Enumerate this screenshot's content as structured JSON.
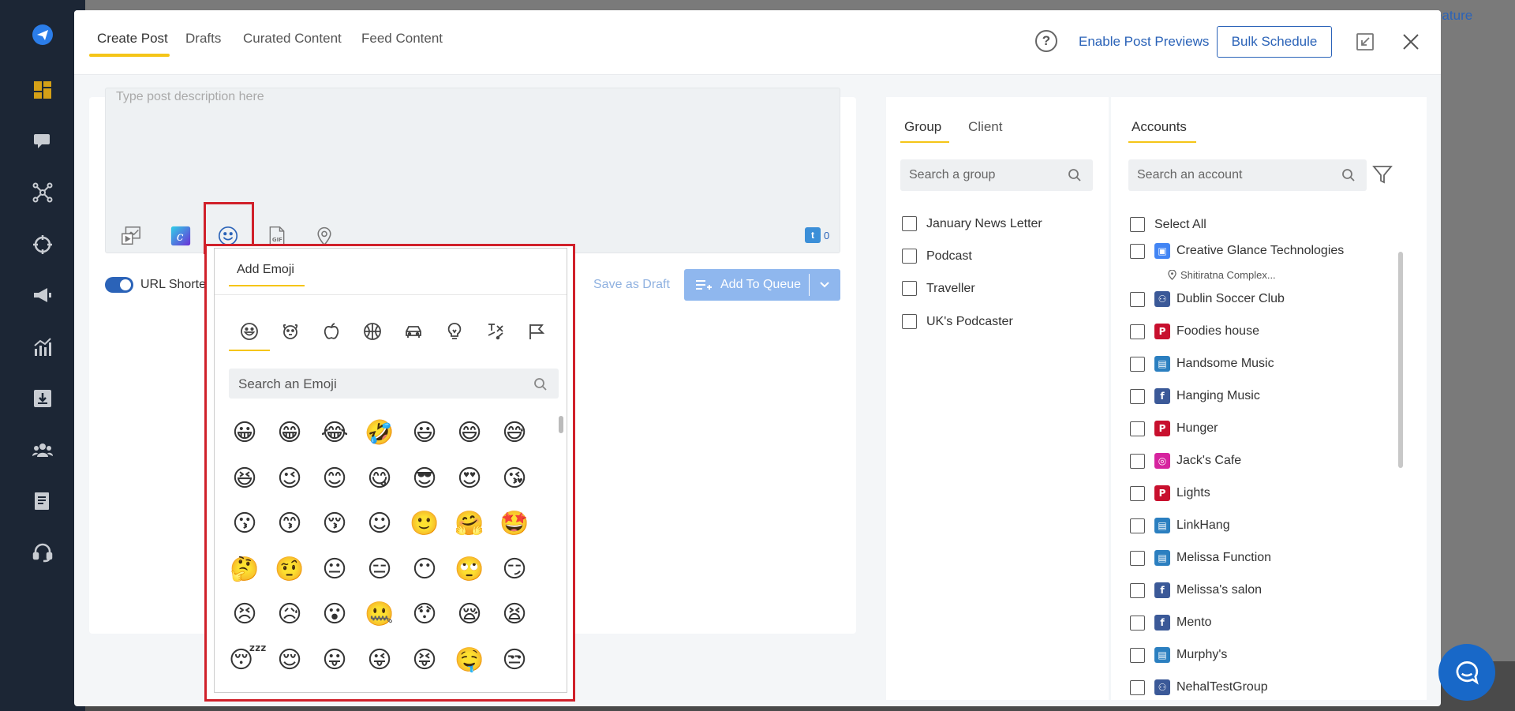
{
  "colors": {
    "accent": "#2b63b8",
    "highlight": "#d0202a",
    "underline": "#f5c518",
    "sidebar": "#1c2635"
  },
  "backdrop": {
    "feature_text": "eature"
  },
  "sidebar": {
    "icons": [
      "logo-plane-icon",
      "dashboard-icon",
      "chat-icon",
      "network-icon",
      "target-icon",
      "megaphone-icon",
      "analytics-icon",
      "download-icon",
      "team-icon",
      "reports-icon",
      "support-headset-icon"
    ]
  },
  "header": {
    "tabs": [
      {
        "label": "Create Post"
      },
      {
        "label": "Drafts"
      },
      {
        "label": "Curated Content"
      },
      {
        "label": "Feed Content"
      }
    ],
    "help_symbol": "?",
    "enable_previews": "Enable Post Previews",
    "bulk_schedule": "Bulk Schedule"
  },
  "composer": {
    "placeholder": "Type post description here",
    "twitter_count": "0",
    "twitter_badge": "t",
    "url_shortener": "URL Shortener",
    "save_as_draft": "Save as Draft",
    "add_to_queue": "Add To Queue"
  },
  "emoji_panel": {
    "tab_label": "Add Emoji",
    "search_placeholder": "Search an Emoji",
    "categories": [
      "smileys-icon",
      "animals-icon",
      "food-icon",
      "activity-icon",
      "travel-icon",
      "objects-icon",
      "symbols-icon",
      "flags-icon"
    ],
    "emojis": [
      [
        "😀",
        "😁",
        "😂",
        "🤣",
        "😃",
        "😄",
        "😅"
      ],
      [
        "😆",
        "😉",
        "😊",
        "😋",
        "😎",
        "😍",
        "😘"
      ],
      [
        "😗",
        "😙",
        "😚",
        "☺",
        "🙂",
        "🤗",
        "🤩"
      ],
      [
        "🤔",
        "🤨",
        "😐",
        "😑",
        "😶",
        "🙄",
        "😏"
      ],
      [
        "😣",
        "😥",
        "😮",
        "🤐",
        "😯",
        "😪",
        "😫"
      ],
      [
        "😴",
        "😌",
        "😛",
        "😜",
        "😝",
        "🤤",
        "😒"
      ]
    ]
  },
  "groups": {
    "tabs": [
      "Group",
      "Client"
    ],
    "search_placeholder": "Search a group",
    "items": [
      "January News Letter",
      "Podcast",
      "Traveller",
      "UK's Podcaster"
    ]
  },
  "accounts": {
    "tab": "Accounts",
    "search_placeholder": "Search an account",
    "select_all": "Select All",
    "items": [
      {
        "name": "Creative Glance Technologies",
        "type": "gmb",
        "sub": "Shitiratna Complex..."
      },
      {
        "name": "Dublin Soccer Club",
        "type": "fbgroup"
      },
      {
        "name": "Foodies house",
        "type": "pinterest"
      },
      {
        "name": "Handsome Music",
        "type": "linkedin"
      },
      {
        "name": "Hanging Music",
        "type": "facebook"
      },
      {
        "name": "Hunger",
        "type": "pinterest"
      },
      {
        "name": "Jack's Cafe",
        "type": "instagram"
      },
      {
        "name": "Lights",
        "type": "pinterest"
      },
      {
        "name": "LinkHang",
        "type": "linkedin"
      },
      {
        "name": "Melissa Function",
        "type": "linkedin"
      },
      {
        "name": "Melissa's salon",
        "type": "facebook"
      },
      {
        "name": "Mento",
        "type": "facebook"
      },
      {
        "name": "Murphy's",
        "type": "linkedin"
      },
      {
        "name": "NehalTestGroup",
        "type": "fbgroup"
      }
    ]
  }
}
